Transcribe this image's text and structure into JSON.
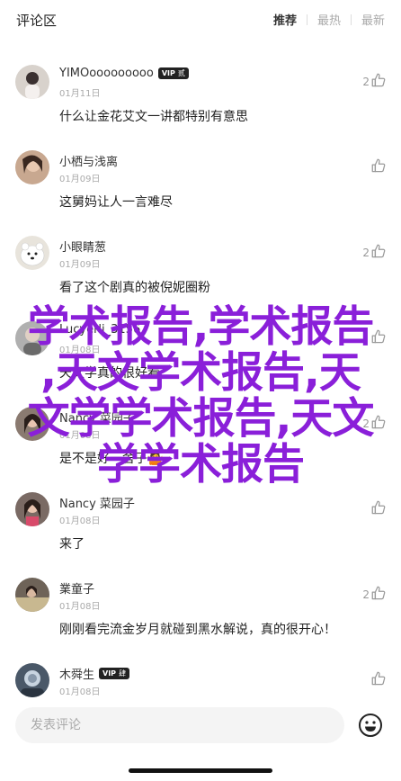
{
  "header": {
    "title": "评论区",
    "tabs": [
      {
        "label": "推荐",
        "active": true
      },
      {
        "label": "最热",
        "active": false
      },
      {
        "label": "最新",
        "active": false
      }
    ]
  },
  "comments": [
    {
      "name": "YIMOooooooooo",
      "badge": {
        "vip": "VIP",
        "level": "贰"
      },
      "date": "01月11日",
      "text": "什么让金花艾文一讲都特别有意思",
      "likes": "2",
      "avatar_color": "#d8d2cc"
    },
    {
      "name": "小栖与浅离",
      "date": "01月09日",
      "text": "这舅妈让人一言难尽",
      "likes": "",
      "avatar_color": "#c8a890"
    },
    {
      "name": "小眼睛葱",
      "date": "01月09日",
      "text": "看了这个剧真的被倪妮圈粉",
      "likes": "2",
      "avatar_color": "#e8e4dc"
    },
    {
      "name": "Lucyerli_3156",
      "date": "01月08日",
      "text": "天文学真的很好看",
      "likes": "",
      "avatar_color": "#b0b0b0"
    },
    {
      "name": "Nancy 菜园子",
      "date": "01月08日",
      "text": "是不是好一舍子🤷",
      "likes": "2",
      "avatar_color": "#8a7a70"
    },
    {
      "name": "Nancy 菜园子",
      "date": "01月08日",
      "text": "来了",
      "likes": "",
      "avatar_color": "#7a6a64"
    },
    {
      "name": "業童子",
      "date": "01月08日",
      "text": "刚刚看完流金岁月就碰到黑水解说，真的很开心！",
      "likes": "2",
      "avatar_color": "#6e6358"
    },
    {
      "name": "木舜生",
      "badge": {
        "vip": "VIP",
        "level": "肆"
      },
      "date": "01月08日",
      "text": "",
      "likes": "",
      "avatar_color": "#4a5868"
    }
  ],
  "watermark": {
    "lines": [
      "学术报告,学术报告",
      ",天文学术报告,天",
      "文学学术报告,天文",
      "学学术报告"
    ],
    "color": "#8a1fd9"
  },
  "input": {
    "placeholder": "发表评论"
  }
}
